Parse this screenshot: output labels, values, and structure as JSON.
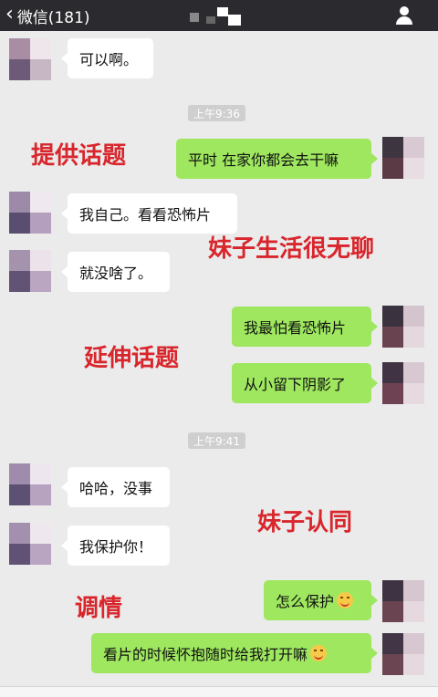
{
  "header": {
    "back_label": "微信(181)"
  },
  "timestamps": [
    "上午9:36",
    "上午9:41"
  ],
  "messages": [
    {
      "side": "left",
      "text": "可以啊。"
    },
    {
      "side": "right",
      "text": "平时 在家你都会去干嘛"
    },
    {
      "side": "left",
      "text": "我自己。看看恐怖片"
    },
    {
      "side": "left",
      "text": "就没啥了。"
    },
    {
      "side": "right",
      "text": "我最怕看恐怖片"
    },
    {
      "side": "right",
      "text": "从小留下阴影了"
    },
    {
      "side": "left",
      "text": "哈哈，没事"
    },
    {
      "side": "left",
      "text": "我保护你！"
    },
    {
      "side": "right",
      "text": "怎么保护",
      "emoji": "smile-emoji"
    },
    {
      "side": "right",
      "text": "看片的时候怀抱随时给我打开嘛",
      "emoji": "smile-emoji"
    }
  ],
  "annotations": [
    "提供话题",
    "妹子生活很无聊",
    "延伸话题",
    "妹子认同",
    "调情"
  ],
  "colors": {
    "topbar": "#2b2b2f",
    "background": "#ebebeb",
    "bubble_self": "#9ee75f",
    "bubble_other": "#ffffff",
    "annotation": "#d8262c"
  }
}
